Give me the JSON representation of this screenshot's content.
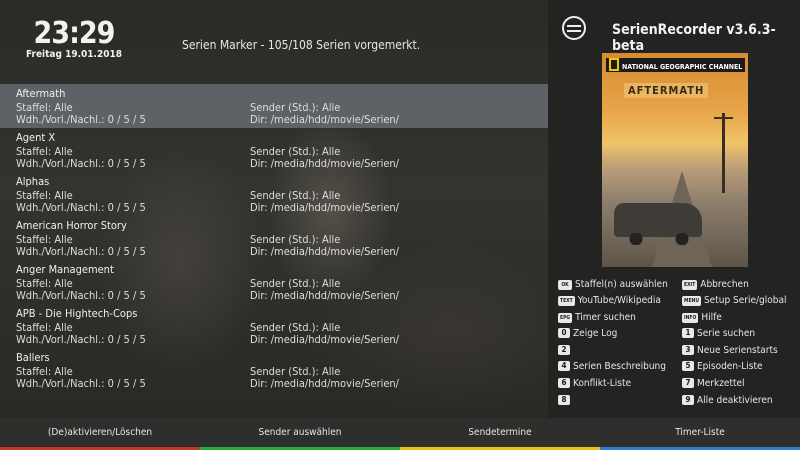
{
  "clock": {
    "time": "23:29",
    "date": "Freitag 19.01.2018"
  },
  "header": {
    "title": "Serien Marker - 105/108 Serien vorgemerkt."
  },
  "entries": [
    {
      "name": "Aftermath",
      "staffel": "Staffel: Alle",
      "wdh": "Wdh./Vorl./Nachl.: 0 / 5 / 5",
      "sender": "Sender (Std.): Alle",
      "dir": "Dir: /media/hdd/movie/Serien/"
    },
    {
      "name": "Agent X",
      "staffel": "Staffel: Alle",
      "wdh": "Wdh./Vorl./Nachl.: 0 / 5 / 5",
      "sender": "Sender (Std.): Alle",
      "dir": "Dir: /media/hdd/movie/Serien/"
    },
    {
      "name": "Alphas",
      "staffel": "Staffel: Alle",
      "wdh": "Wdh./Vorl./Nachl.: 0 / 5 / 5",
      "sender": "Sender (Std.): Alle",
      "dir": "Dir: /media/hdd/movie/Serien/"
    },
    {
      "name": "American Horror Story",
      "staffel": "Staffel: Alle",
      "wdh": "Wdh./Vorl./Nachl.: 0 / 5 / 5",
      "sender": "Sender (Std.): Alle",
      "dir": "Dir: /media/hdd/movie/Serien/"
    },
    {
      "name": "Anger Management",
      "staffel": "Staffel: Alle",
      "wdh": "Wdh./Vorl./Nachl.: 0 / 5 / 5",
      "sender": "Sender (Std.): Alle",
      "dir": "Dir: /media/hdd/movie/Serien/"
    },
    {
      "name": "APB - Die Hightech-Cops",
      "staffel": "Staffel: Alle",
      "wdh": "Wdh./Vorl./Nachl.: 0 / 5 / 5",
      "sender": "Sender (Std.): Alle",
      "dir": "Dir: /media/hdd/movie/Serien/"
    },
    {
      "name": "Ballers",
      "staffel": "Staffel: Alle",
      "wdh": "Wdh./Vorl./Nachl.: 0 / 5 / 5",
      "sender": "Sender (Std.): Alle",
      "dir": "Dir: /media/hdd/movie/Serien/"
    }
  ],
  "sidebar": {
    "app_title": "SerienRecorder v3.6.3-beta",
    "poster": {
      "channel": "NATIONAL GEOGRAPHIC CHANNEL",
      "title": "AFTERMATH"
    },
    "keys": [
      {
        "key": "OK",
        "label": "Staffel(n) auswählen"
      },
      {
        "key": "EXIT",
        "label": "Abbrechen"
      },
      {
        "key": "TEXT",
        "label": "YouTube/Wikipedia"
      },
      {
        "key": "MENU",
        "label": "Setup Serie/global"
      },
      {
        "key": "EPG",
        "label": "Timer suchen"
      },
      {
        "key": "INFO",
        "label": "Hilfe"
      },
      {
        "key": "0",
        "label": "Zeige Log"
      },
      {
        "key": "1",
        "label": "Serie suchen"
      },
      {
        "key": "2",
        "label": ""
      },
      {
        "key": "3",
        "label": "Neue Serienstarts"
      },
      {
        "key": "4",
        "label": "Serien Beschreibung"
      },
      {
        "key": "5",
        "label": "Episoden-Liste"
      },
      {
        "key": "6",
        "label": "Konflikt-Liste"
      },
      {
        "key": "7",
        "label": "Merkzettel"
      },
      {
        "key": "8",
        "label": ""
      },
      {
        "key": "9",
        "label": "Alle deaktivieren"
      }
    ]
  },
  "bottom_buttons": [
    {
      "label": "(De)aktivieren/Löschen",
      "color": "#c0392b"
    },
    {
      "label": "Sender auswählen",
      "color": "#27ae3a"
    },
    {
      "label": "Sendetermine",
      "color": "#e6c21a"
    },
    {
      "label": "Timer-Liste",
      "color": "#2f7fd1"
    }
  ]
}
